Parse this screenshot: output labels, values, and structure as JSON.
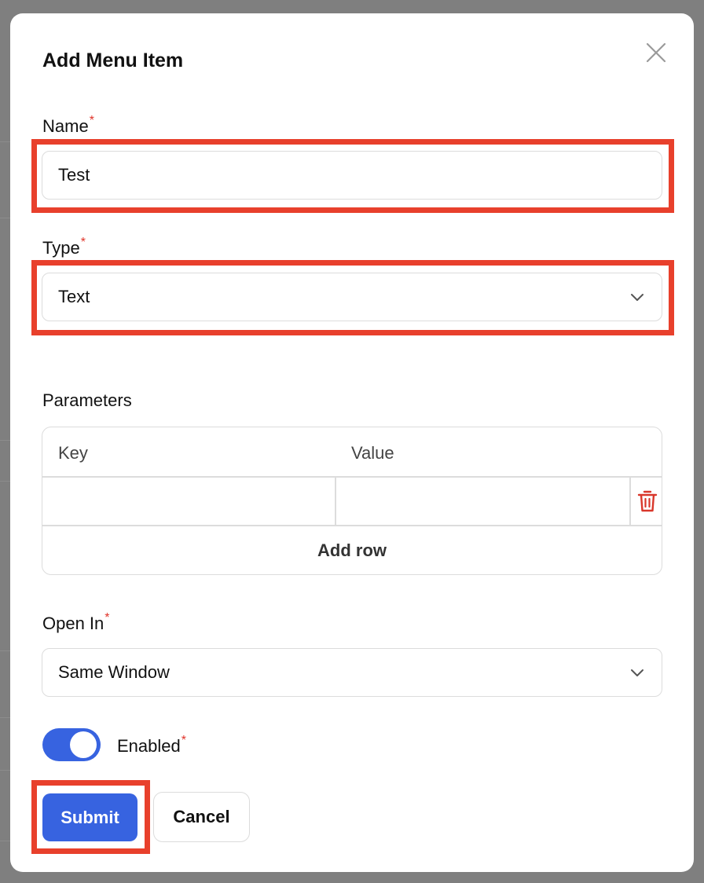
{
  "modal": {
    "title": "Add Menu Item",
    "close_icon": "close-icon"
  },
  "form": {
    "name": {
      "label": "Name",
      "required_mark": "*",
      "value": "Test"
    },
    "type": {
      "label": "Type",
      "required_mark": "*",
      "selected": "Text",
      "icon": "chevron-down-icon"
    },
    "parameters": {
      "label": "Parameters",
      "columns": [
        "Key",
        "Value"
      ],
      "rows": [
        {
          "key": "",
          "value": ""
        }
      ],
      "delete_icon": "trash-icon",
      "add_row_label": "Add row"
    },
    "open_in": {
      "label": "Open In",
      "required_mark": "*",
      "selected": "Same Window",
      "icon": "chevron-down-icon"
    },
    "enabled": {
      "label": "Enabled",
      "required_mark": "*",
      "on": true
    }
  },
  "actions": {
    "submit_label": "Submit",
    "cancel_label": "Cancel"
  },
  "colors": {
    "primary": "#3763e0",
    "danger": "#d9372b",
    "highlight": "#e8402c",
    "required": "#e0342a"
  }
}
